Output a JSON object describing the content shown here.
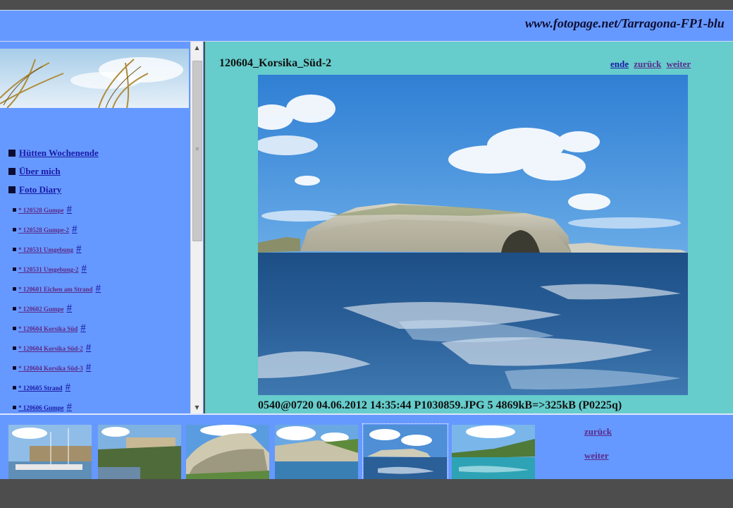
{
  "header": {
    "site_url": "www.fotopage.net/Tarragona-FP1-blu"
  },
  "sidebar": {
    "main_items": [
      {
        "label": "Hütten Wochenende"
      },
      {
        "label": "Über mich"
      },
      {
        "label": "Foto Diary"
      }
    ],
    "sub_items": [
      {
        "label": "* 120528  Gumpe",
        "hash": "#"
      },
      {
        "label": "* 120528  Gumpe-2",
        "hash": "#"
      },
      {
        "label": "* 120531  Umgebung",
        "hash": "#"
      },
      {
        "label": "* 120531  Umgebung-2",
        "hash": "#"
      },
      {
        "label": "* 120601  Eichen  am  Strand",
        "hash": "#"
      },
      {
        "label": "* 120602  Gumpe",
        "hash": "#"
      },
      {
        "label": "* 120604  Korsika  Süd",
        "hash": "#"
      },
      {
        "label": "* 120604  Korsika  Süd-2",
        "hash": "#"
      },
      {
        "label": "* 120604  Korsika  Süd-3",
        "hash": "#"
      },
      {
        "label": "* 120605  Strand",
        "hash": "#"
      },
      {
        "label": "* 120606  Gumpe",
        "hash": "#"
      }
    ]
  },
  "content": {
    "title": "120604_Korsika_Süd-2",
    "nav": {
      "end": "ende",
      "back": "zurück",
      "next": "weiter"
    },
    "caption": "0540@0720 04.06.2012 14:35:44 P1030859.JPG 5 4869kB=>325kB (P0225q)"
  },
  "thumbstrip": {
    "back": "zurück",
    "next": "weiter",
    "thumbnails": [
      {
        "name": "harbor"
      },
      {
        "name": "fortress"
      },
      {
        "name": "cliffs"
      },
      {
        "name": "cliffs-sea"
      },
      {
        "name": "island-sea",
        "selected": true
      },
      {
        "name": "coast-turquoise"
      }
    ]
  },
  "colors": {
    "frame_blue": "#6699ff",
    "content_teal": "#66cccc",
    "background_gray": "#4d4d4d",
    "link": "#1a1aa6"
  }
}
